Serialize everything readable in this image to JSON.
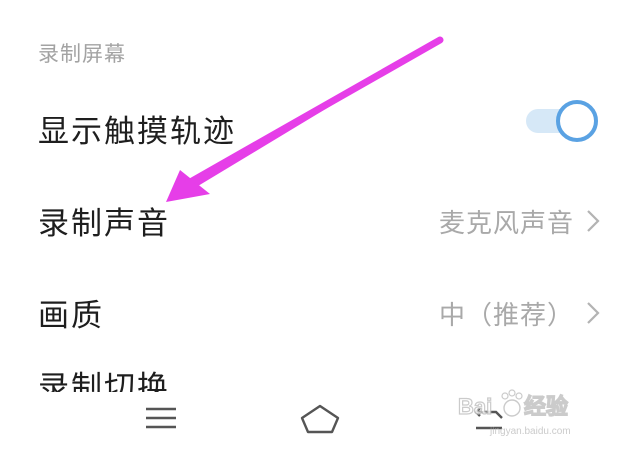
{
  "settings": {
    "section_title": "录制屏幕",
    "rows": [
      {
        "label": "显示触摸轨迹",
        "toggle_on": true
      },
      {
        "label": "录制声音",
        "value": "麦克风声音"
      },
      {
        "label": "画质",
        "value": "中（推荐）"
      },
      {
        "label": "录制切换"
      }
    ]
  },
  "navbar": {
    "buttons": [
      "menu-icon",
      "home-icon",
      "back-icon"
    ]
  },
  "watermark": {
    "text": "Bai du 经验",
    "url": "jingyan.baidu.com"
  },
  "colors": {
    "accent": "#5aa2e3",
    "annotation_arrow": "#e63ee8"
  }
}
